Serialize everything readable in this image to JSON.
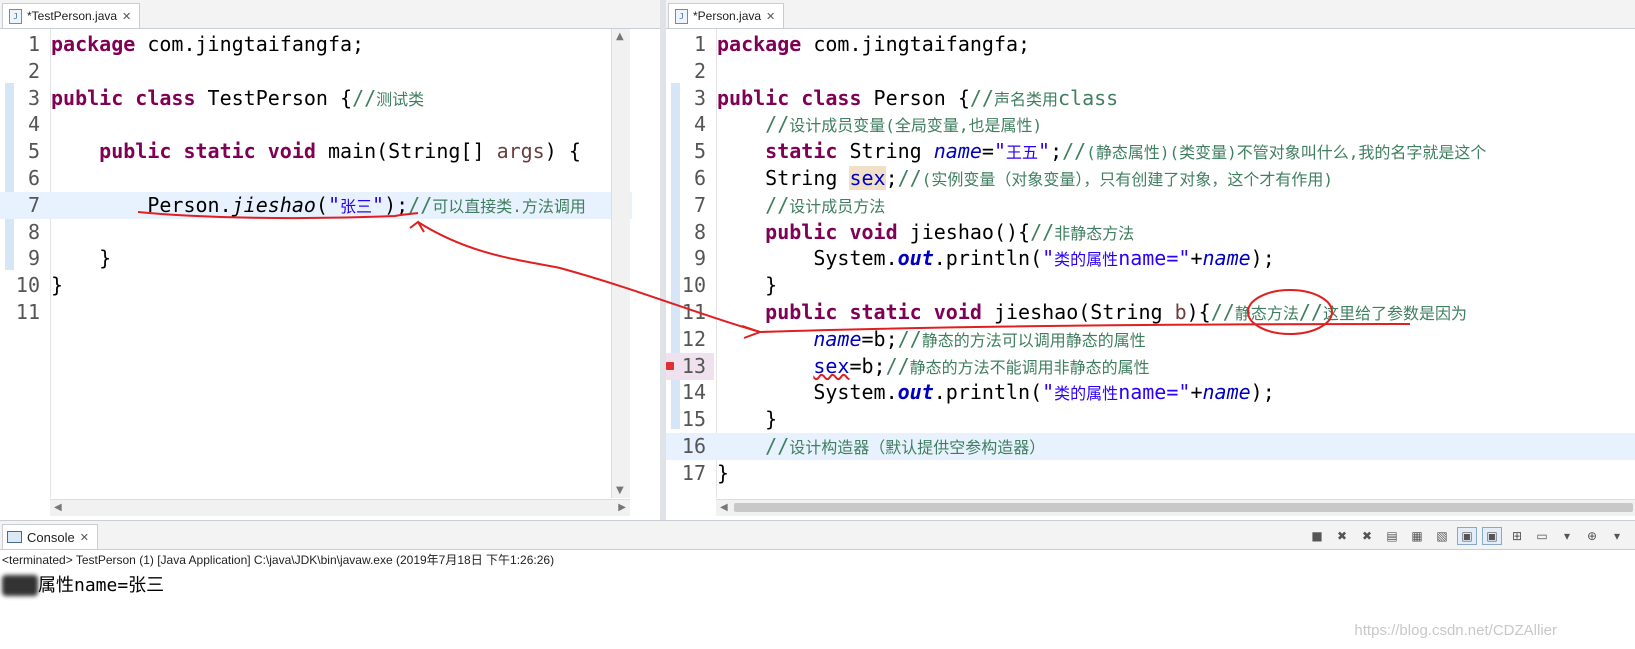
{
  "left_editor": {
    "tab_label": "*TestPerson.java",
    "lines": [
      {
        "n": "1",
        "segs": [
          {
            "t": "package",
            "c": "kw"
          },
          {
            "t": " com.jingtaifangfa;",
            "c": ""
          }
        ]
      },
      {
        "n": "2",
        "segs": []
      },
      {
        "n": "3",
        "segs": [
          {
            "t": "public",
            "c": "kw"
          },
          {
            "t": " ",
            "c": ""
          },
          {
            "t": "class",
            "c": "kw"
          },
          {
            "t": " TestPerson {",
            "c": ""
          },
          {
            "t": "//",
            "c": "cm"
          },
          {
            "t": "测试类",
            "c": "cm cm-small"
          }
        ]
      },
      {
        "n": "4",
        "segs": []
      },
      {
        "n": "5",
        "segs": [
          {
            "t": "    ",
            "c": ""
          },
          {
            "t": "public",
            "c": "kw"
          },
          {
            "t": " ",
            "c": ""
          },
          {
            "t": "static",
            "c": "kw"
          },
          {
            "t": " ",
            "c": ""
          },
          {
            "t": "void",
            "c": "kw"
          },
          {
            "t": " main(String[] ",
            "c": ""
          },
          {
            "t": "args",
            "c": "cm-args"
          },
          {
            "t": ") {",
            "c": ""
          }
        ]
      },
      {
        "n": "6",
        "segs": []
      },
      {
        "n": "7",
        "segs": [
          {
            "t": "        Person.",
            "c": ""
          },
          {
            "t": "jieshao",
            "c": "italic"
          },
          {
            "t": "(",
            "c": ""
          },
          {
            "t": "\"",
            "c": "str"
          },
          {
            "t": "张三",
            "c": "str str-small"
          },
          {
            "t": "\"",
            "c": "str"
          },
          {
            "t": ");",
            "c": ""
          },
          {
            "t": "//",
            "c": "cm"
          },
          {
            "t": "可以直接类.方法调用",
            "c": "cm cm-small"
          }
        ],
        "current": true
      },
      {
        "n": "8",
        "segs": []
      },
      {
        "n": "9",
        "segs": [
          {
            "t": "    }",
            "c": ""
          }
        ]
      },
      {
        "n": "10",
        "segs": [
          {
            "t": "}",
            "c": ""
          }
        ]
      },
      {
        "n": "11",
        "segs": []
      }
    ]
  },
  "right_editor": {
    "tab_label": "*Person.java",
    "lines": [
      {
        "n": "1",
        "segs": [
          {
            "t": "package",
            "c": "kw"
          },
          {
            "t": " com.jingtaifangfa;",
            "c": ""
          }
        ]
      },
      {
        "n": "2",
        "segs": []
      },
      {
        "n": "3",
        "segs": [
          {
            "t": "public",
            "c": "kw"
          },
          {
            "t": " ",
            "c": ""
          },
          {
            "t": "class",
            "c": "kw"
          },
          {
            "t": " Person {",
            "c": ""
          },
          {
            "t": "//",
            "c": "cm"
          },
          {
            "t": "声名类用",
            "c": "cm cm-small"
          },
          {
            "t": "class",
            "c": "cm"
          }
        ]
      },
      {
        "n": "4",
        "segs": [
          {
            "t": "    ",
            "c": ""
          },
          {
            "t": "//",
            "c": "cm"
          },
          {
            "t": "设计成员变量(全局变量,也是属性)",
            "c": "cm cm-small"
          }
        ]
      },
      {
        "n": "5",
        "segs": [
          {
            "t": "    ",
            "c": ""
          },
          {
            "t": "static",
            "c": "kw"
          },
          {
            "t": " String ",
            "c": ""
          },
          {
            "t": "name",
            "c": "field"
          },
          {
            "t": "=",
            "c": ""
          },
          {
            "t": "\"",
            "c": "str"
          },
          {
            "t": "王五",
            "c": "str str-small"
          },
          {
            "t": "\"",
            "c": "str"
          },
          {
            "t": ";",
            "c": ""
          },
          {
            "t": "//",
            "c": "cm"
          },
          {
            "t": "(静态属性)(类变量)不管对象叫什么,我的名字就是这个",
            "c": "cm cm-small"
          }
        ]
      },
      {
        "n": "6",
        "segs": [
          {
            "t": "    String ",
            "c": ""
          },
          {
            "t": "sex",
            "c": "fieldnb hl-sex"
          },
          {
            "t": ";",
            "c": ""
          },
          {
            "t": "//",
            "c": "cm"
          },
          {
            "t": "(实例变量（对象变量），只有创建了对象，这个才有作用)",
            "c": "cm cm-small"
          }
        ]
      },
      {
        "n": "7",
        "segs": [
          {
            "t": "    ",
            "c": ""
          },
          {
            "t": "//",
            "c": "cm"
          },
          {
            "t": "设计成员方法",
            "c": "cm cm-small"
          }
        ]
      },
      {
        "n": "8",
        "segs": [
          {
            "t": "    ",
            "c": ""
          },
          {
            "t": "public",
            "c": "kw"
          },
          {
            "t": " ",
            "c": ""
          },
          {
            "t": "void",
            "c": "kw"
          },
          {
            "t": " jieshao(){",
            "c": ""
          },
          {
            "t": "//",
            "c": "cm"
          },
          {
            "t": "非静态方法",
            "c": "cm cm-small"
          }
        ]
      },
      {
        "n": "9",
        "segs": [
          {
            "t": "        System.",
            "c": ""
          },
          {
            "t": "out",
            "c": "bolditalic"
          },
          {
            "t": ".println(",
            "c": ""
          },
          {
            "t": "\"",
            "c": "str"
          },
          {
            "t": "类的属性",
            "c": "str str-small"
          },
          {
            "t": "name=\"",
            "c": "str"
          },
          {
            "t": "+",
            "c": ""
          },
          {
            "t": "name",
            "c": "field"
          },
          {
            "t": ");",
            "c": ""
          }
        ]
      },
      {
        "n": "10",
        "segs": [
          {
            "t": "    }",
            "c": ""
          }
        ]
      },
      {
        "n": "11",
        "segs": [
          {
            "t": "    ",
            "c": ""
          },
          {
            "t": "public",
            "c": "kw"
          },
          {
            "t": " ",
            "c": ""
          },
          {
            "t": "static",
            "c": "kw"
          },
          {
            "t": " ",
            "c": ""
          },
          {
            "t": "void",
            "c": "kw"
          },
          {
            "t": " jieshao(String ",
            "c": ""
          },
          {
            "t": "b",
            "c": "cm-args"
          },
          {
            "t": "){",
            "c": ""
          },
          {
            "t": "//",
            "c": "cm"
          },
          {
            "t": "静态方法",
            "c": "cm cm-small"
          },
          {
            "t": "//",
            "c": "cm"
          },
          {
            "t": "这里给了参数是因为",
            "c": "cm cm-small"
          }
        ]
      },
      {
        "n": "12",
        "segs": [
          {
            "t": "        ",
            "c": ""
          },
          {
            "t": "name",
            "c": "field"
          },
          {
            "t": "=b;",
            "c": ""
          },
          {
            "t": "//",
            "c": "cm"
          },
          {
            "t": "静态的方法可以调用静态的属性",
            "c": "cm cm-small"
          }
        ]
      },
      {
        "n": "13",
        "segs": [
          {
            "t": "        ",
            "c": ""
          },
          {
            "t": "sex",
            "c": "fieldnb err"
          },
          {
            "t": "=b;",
            "c": ""
          },
          {
            "t": "//",
            "c": "cm"
          },
          {
            "t": "静态的方法不能调用非静态的属性",
            "c": "cm cm-small"
          }
        ],
        "error": true
      },
      {
        "n": "14",
        "segs": [
          {
            "t": "        System.",
            "c": ""
          },
          {
            "t": "out",
            "c": "bolditalic"
          },
          {
            "t": ".println(",
            "c": ""
          },
          {
            "t": "\"",
            "c": "str"
          },
          {
            "t": "类的属性",
            "c": "str str-small"
          },
          {
            "t": "name=\"",
            "c": "str"
          },
          {
            "t": "+",
            "c": ""
          },
          {
            "t": "name",
            "c": "field"
          },
          {
            "t": ");",
            "c": ""
          }
        ]
      },
      {
        "n": "15",
        "segs": [
          {
            "t": "    }",
            "c": ""
          }
        ]
      },
      {
        "n": "16",
        "segs": [
          {
            "t": "    ",
            "c": ""
          },
          {
            "t": "//",
            "c": "cm"
          },
          {
            "t": "设计构造器（默认提供空参构造器）",
            "c": "cm cm-small"
          }
        ],
        "current": true
      },
      {
        "n": "17",
        "segs": [
          {
            "t": "}",
            "c": ""
          }
        ]
      }
    ]
  },
  "console": {
    "tab_label": "Console",
    "status": "<terminated> TestPerson (1) [Java Application] C:\\java\\JDK\\bin\\javaw.exe (2019年7月18日 下午1:26:26)",
    "output_hidden": "类的",
    "output_visible": "属性name=张三"
  },
  "watermark": "https://blog.csdn.net/CDZAllier",
  "colors": {
    "keyword": "#7f0055",
    "comment": "#3f7f5f",
    "string": "#2a00ff",
    "field": "#0000c0",
    "annotation_red": "#e02020"
  },
  "icons": [
    "java-file-icon",
    "close-icon",
    "console-icon",
    "error-marker-icon",
    "fold-icon"
  ]
}
